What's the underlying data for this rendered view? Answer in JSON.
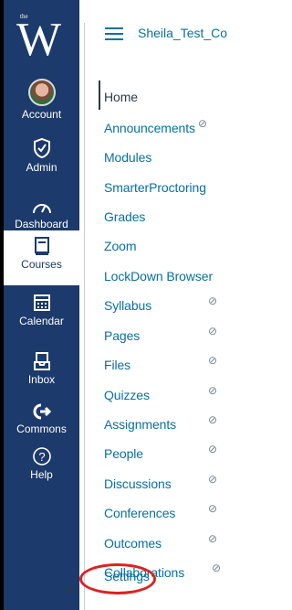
{
  "global_nav": {
    "logo_letter": "W",
    "logo_small": "the",
    "items": [
      {
        "label": "Account",
        "icon": "avatar"
      },
      {
        "label": "Admin",
        "icon": "shield-icon"
      },
      {
        "label": "Dashboard",
        "icon": "dashboard-icon"
      },
      {
        "label": "Courses",
        "icon": "book-icon",
        "active": true
      },
      {
        "label": "Calendar",
        "icon": "calendar-icon"
      },
      {
        "label": "Inbox",
        "icon": "inbox-icon"
      },
      {
        "label": "Commons",
        "icon": "commons-icon"
      },
      {
        "label": "Help",
        "icon": "help-icon"
      }
    ]
  },
  "header": {
    "course_title": "Sheila_Test_Co"
  },
  "course_nav": [
    {
      "label": "Home",
      "active": true
    },
    {
      "label": "Announcements",
      "hidden": true
    },
    {
      "label": "Modules"
    },
    {
      "label": "SmarterProctoring"
    },
    {
      "label": "Grades"
    },
    {
      "label": "Zoom"
    },
    {
      "label": "LockDown Browser"
    },
    {
      "label": "Syllabus",
      "hidden": true
    },
    {
      "label": "Pages",
      "hidden": true
    },
    {
      "label": "Files",
      "hidden": true
    },
    {
      "label": "Quizzes",
      "hidden": true
    },
    {
      "label": "Assignments",
      "hidden": true
    },
    {
      "label": "People",
      "hidden": true
    },
    {
      "label": "Discussions",
      "hidden": true
    },
    {
      "label": "Conferences",
      "hidden": true
    },
    {
      "label": "Outcomes",
      "hidden": true
    },
    {
      "label": "Collaborations",
      "hidden": true
    },
    {
      "label": "Settings",
      "highlighted": true
    }
  ],
  "hidden_icon_glyph": "⊘",
  "stray_text": "e",
  "colors": {
    "nav_bg": "#1c3a6b",
    "link": "#0770a3",
    "highlight": "#e02020"
  }
}
